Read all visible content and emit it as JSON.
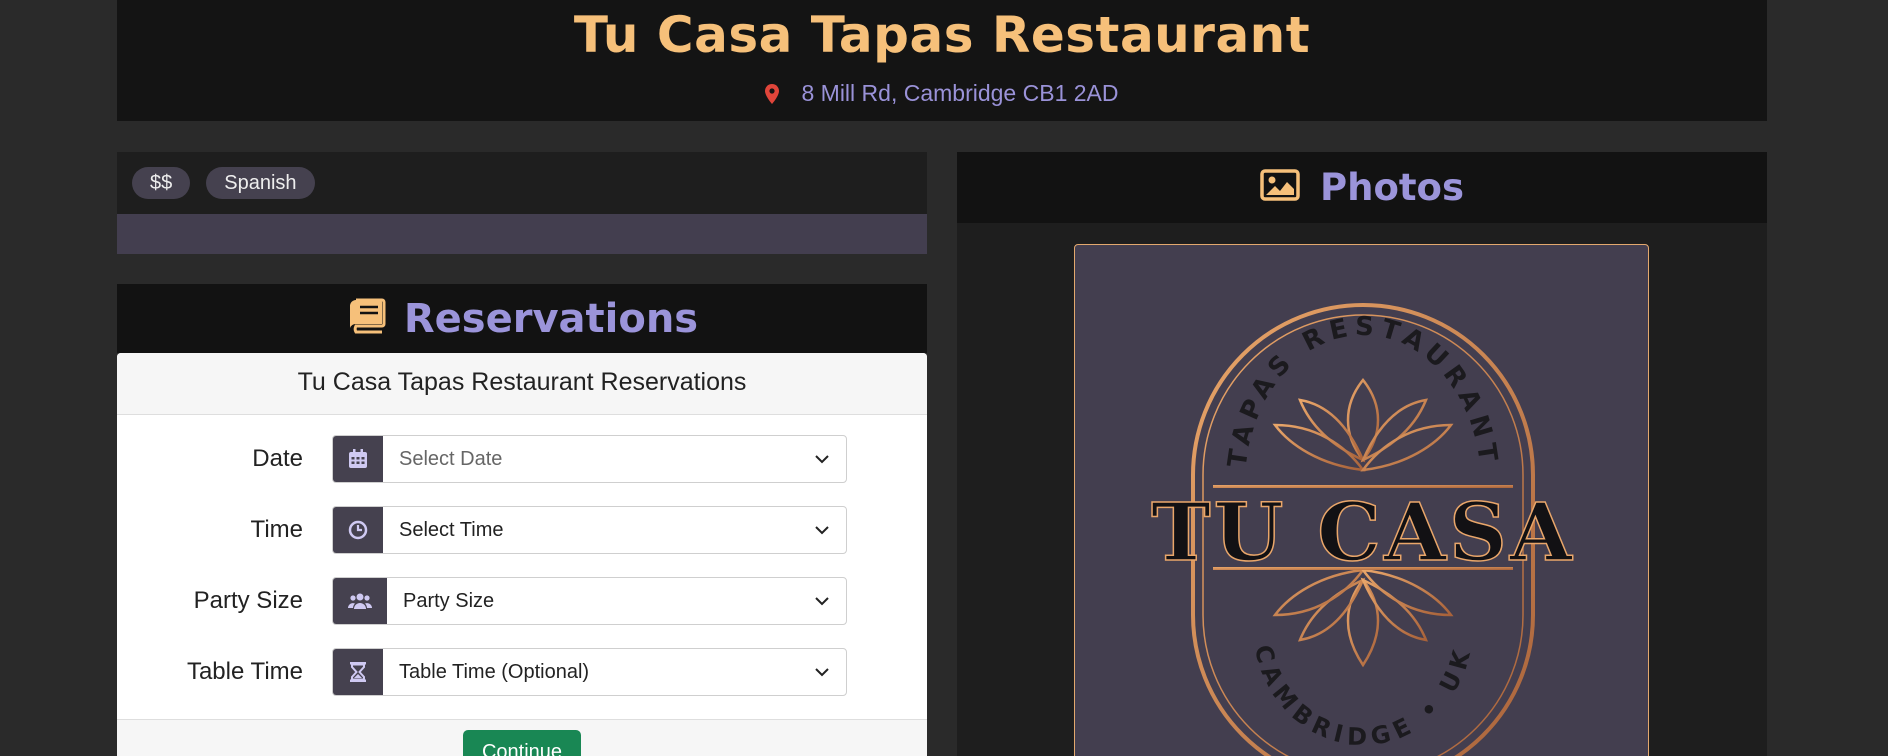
{
  "header": {
    "title": "Tu Casa Tapas Restaurant",
    "address": "8 Mill Rd, Cambridge CB1 2AD",
    "pin_icon": "map-marker-icon"
  },
  "tags": [
    "$$",
    "Spanish"
  ],
  "reservations": {
    "heading": "Reservations",
    "icon": "book-icon",
    "card_title": "Tu Casa Tapas Restaurant Reservations",
    "fields": [
      {
        "label": "Date",
        "value": "Select Date",
        "icon": "calendar-icon"
      },
      {
        "label": "Time",
        "value": "Select Time",
        "icon": "clock-icon"
      },
      {
        "label": "Party Size",
        "value": "Party Size",
        "icon": "users-icon"
      },
      {
        "label": "Table Time",
        "value": "Table Time (Optional)",
        "icon": "hourglass-icon"
      }
    ],
    "continue_label": "Continue"
  },
  "photos": {
    "heading": "Photos",
    "icon": "image-icon",
    "logo": {
      "top_text": "TAPAS RESTAURANT",
      "main_text": "TU CASA",
      "bottom_text": "CAMBRIDGE • UK"
    }
  },
  "colors": {
    "accent_gold": "#f6c07a",
    "accent_purple": "#9b94da",
    "panel_dark": "#121212",
    "button_green": "#198754",
    "pin_red": "#e0453a"
  }
}
